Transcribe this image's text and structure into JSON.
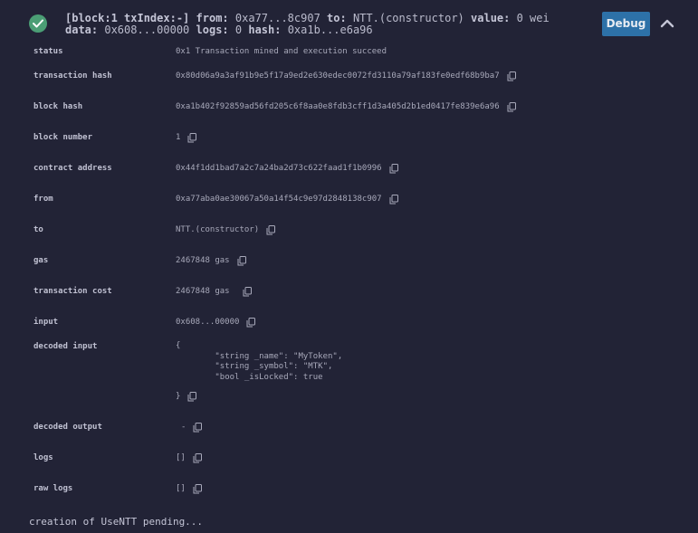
{
  "summary": {
    "block_label": "[block:1 txIndex:-]",
    "from_label": "from:",
    "from_value": "0xa77...8c907",
    "to_label": "to:",
    "to_value": "NTT.(constructor)",
    "value_label": "value:",
    "value_value": "0 wei",
    "data_label": "data:",
    "data_value": "0x608...00000",
    "logs_label": "logs:",
    "logs_value": "0",
    "hash_label": "hash:",
    "hash_value": "0xa1b...e6a96",
    "status_color": "#4b9e75"
  },
  "toolbar": {
    "debug_label": "Debug"
  },
  "details": {
    "status": {
      "key": "status",
      "value": "0x1 Transaction mined and execution succeed"
    },
    "transaction_hash": {
      "key": "transaction hash",
      "value": "0x80d06a9a3af91b9e5f17a9ed2e630edec0072fd3110a79af183fe0edf68b9ba7"
    },
    "block_hash": {
      "key": "block hash",
      "value": "0xa1b402f92859ad56fd205c6f8aa0e8fdb3cff1d3a405d2b1ed0417fe839e6a96"
    },
    "block_number": {
      "key": "block number",
      "value": "1"
    },
    "contract_address": {
      "key": "contract address",
      "value": "0x44f1dd1bad7a2c7a24ba2d73c622faad1f1b0996"
    },
    "from": {
      "key": "from",
      "value": "0xa77aba0ae30067a50a14f54c9e97d2848138c907"
    },
    "to": {
      "key": "to",
      "value": "NTT.(constructor)"
    },
    "gas": {
      "key": "gas",
      "value": "2467848 gas"
    },
    "transaction_cost": {
      "key": "transaction cost",
      "value": "2467848 gas"
    },
    "input": {
      "key": "input",
      "value": "0x608...00000"
    },
    "decoded_input": {
      "key": "decoded input",
      "open": "{",
      "lines": [
        "\"string _name\": \"MyToken\",",
        "\"string _symbol\": \"MTK\",",
        "\"bool _isLocked\": true"
      ],
      "close": "}"
    },
    "decoded_output": {
      "key": "decoded output",
      "value": "-"
    },
    "logs": {
      "key": "logs",
      "value": "[]"
    },
    "raw_logs": {
      "key": "raw logs",
      "value": "[]"
    }
  },
  "footer": {
    "message": "creation of UseNTT pending..."
  }
}
